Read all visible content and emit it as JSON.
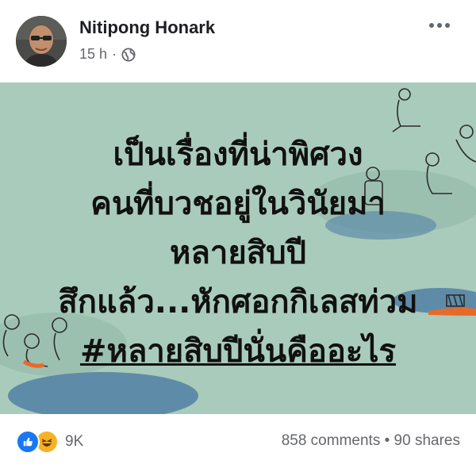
{
  "post": {
    "author": "Nitipong Honark",
    "time": "15 h",
    "separator": "·",
    "privacy_icon": "globe-icon",
    "image_text": {
      "line1": "เป็นเรื่องที่น่าพิศวง",
      "line2": "คนที่บวชอยู่ในวินัยมา",
      "line3": "หลายสิบปี",
      "line4": "สึกแล้ว...หักศอกกิเลสท่วม",
      "hashtag": "#หลายสิบปีนั่นคืออะไร"
    },
    "image_background": "#a9cbbb"
  },
  "footer": {
    "reaction_icons": [
      "like-icon",
      "haha-icon"
    ],
    "reaction_count": "9K",
    "comments": "858 comments",
    "dot": "•",
    "shares": "90 shares"
  }
}
